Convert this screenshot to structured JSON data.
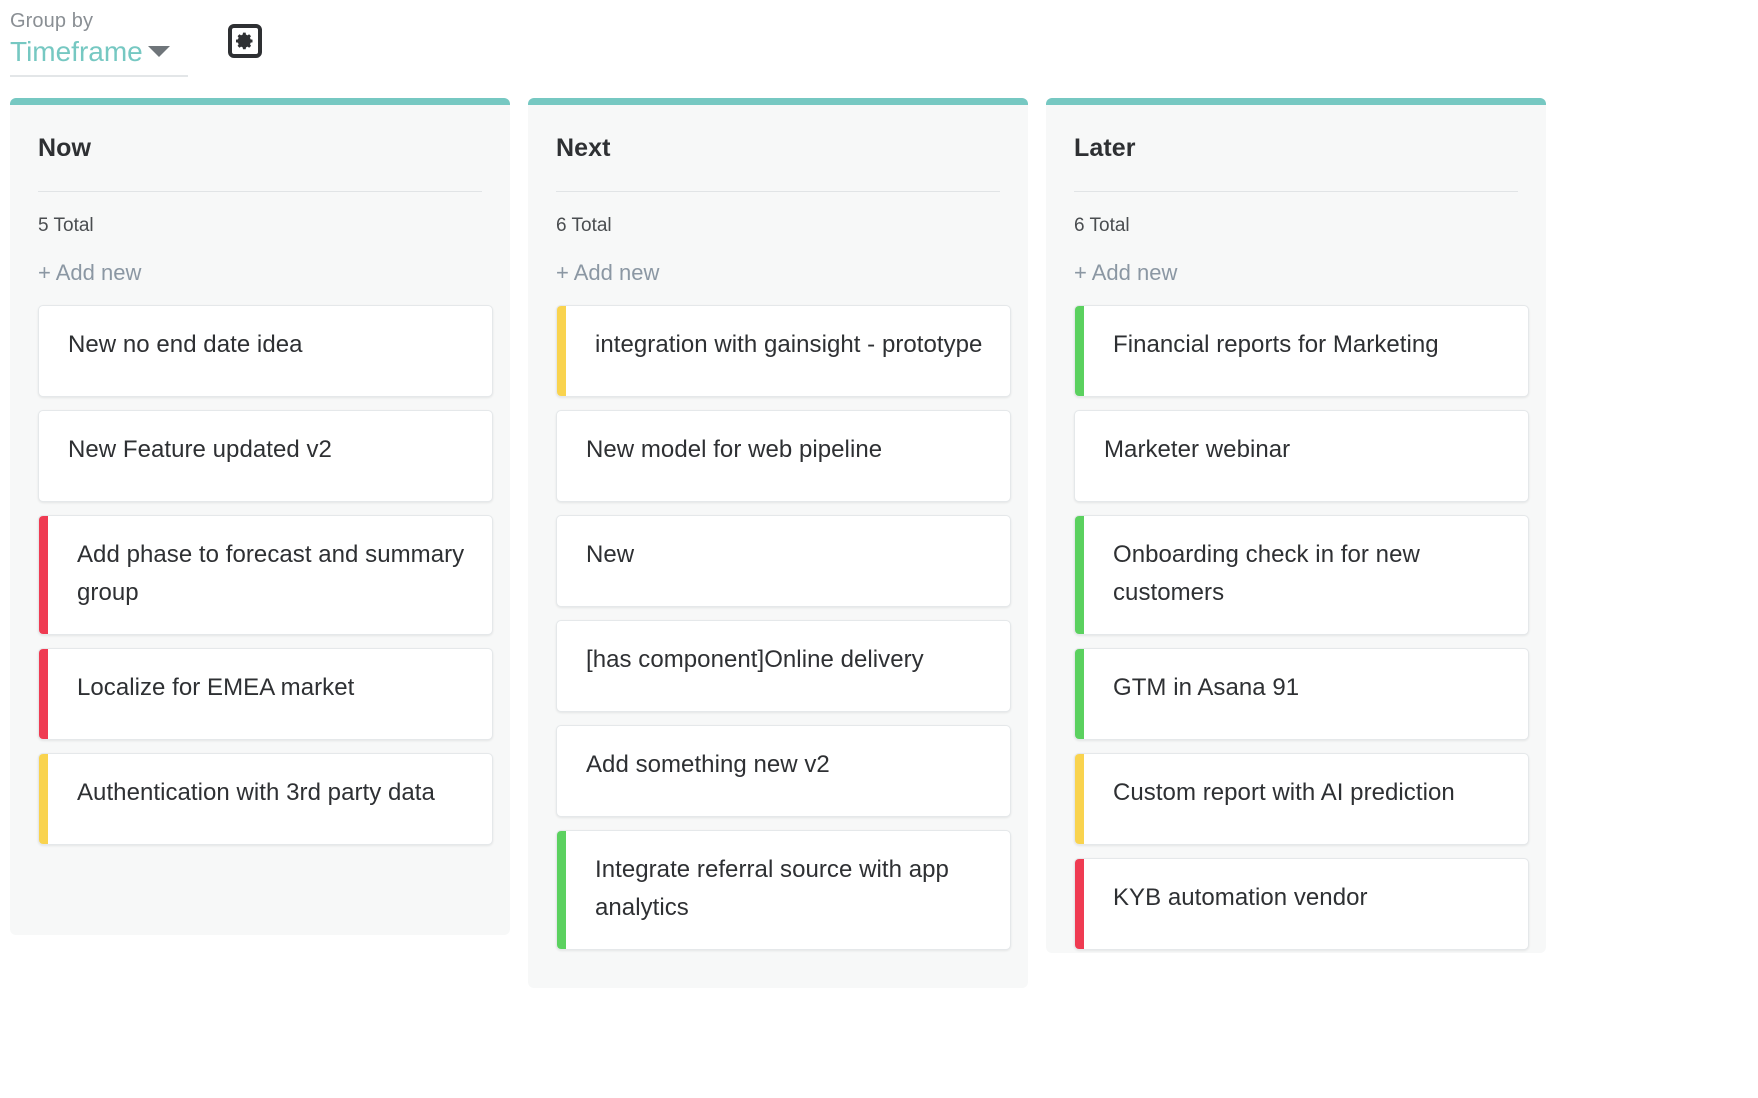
{
  "toolbar": {
    "group_by_label": "Group by",
    "group_by_value": "Timeframe",
    "caret_icon": "chevron-down-icon",
    "settings_icon": "gear-icon"
  },
  "board": {
    "add_new_label": "+ Add new",
    "colors": {
      "accent_teal": "#76c8c2",
      "bar_red": "#ef3b52",
      "bar_yellow": "#f9d34e",
      "bar_green": "#5bd15f",
      "column_bg": "#f7f8f8",
      "card_bg": "#ffffff",
      "text": "#2e3033",
      "muted": "#8b97a3"
    },
    "columns": [
      {
        "title": "Now",
        "total": "5 Total",
        "add_new": "+ Add new",
        "cards": [
          {
            "title": "New no end date idea",
            "bar": "none"
          },
          {
            "title": "New Feature updated v2",
            "bar": "none"
          },
          {
            "title": "Add phase to forecast and summary group",
            "bar": "#ef3b52"
          },
          {
            "title": "Localize for EMEA market",
            "bar": "#ef3b52"
          },
          {
            "title": "Authentication with 3rd party data",
            "bar": "#f9d34e"
          }
        ]
      },
      {
        "title": "Next",
        "total": "6 Total",
        "add_new": "+ Add new",
        "cards": [
          {
            "title": "integration with gainsight - prototype",
            "bar": "#f9d34e"
          },
          {
            "title": "New model for web pipeline",
            "bar": "none"
          },
          {
            "title": "New",
            "bar": "none"
          },
          {
            "title": "[has component]Online delivery",
            "bar": "none"
          },
          {
            "title": "Add something new v2",
            "bar": "none"
          },
          {
            "title": "Integrate referral source with app analytics",
            "bar": "#5bd15f"
          }
        ]
      },
      {
        "title": "Later",
        "total": "6 Total",
        "add_new": "+ Add new",
        "cards": [
          {
            "title": "Financial reports for Marketing",
            "bar": "#5bd15f"
          },
          {
            "title": "Marketer webinar",
            "bar": "none"
          },
          {
            "title": "Onboarding check in for new customers",
            "bar": "#5bd15f"
          },
          {
            "title": "GTM in Asana 91",
            "bar": "#5bd15f"
          },
          {
            "title": "Custom report with AI prediction",
            "bar": "#f9d34e"
          },
          {
            "title": "KYB automation vendor",
            "bar": "#ef3b52"
          }
        ]
      }
    ]
  }
}
